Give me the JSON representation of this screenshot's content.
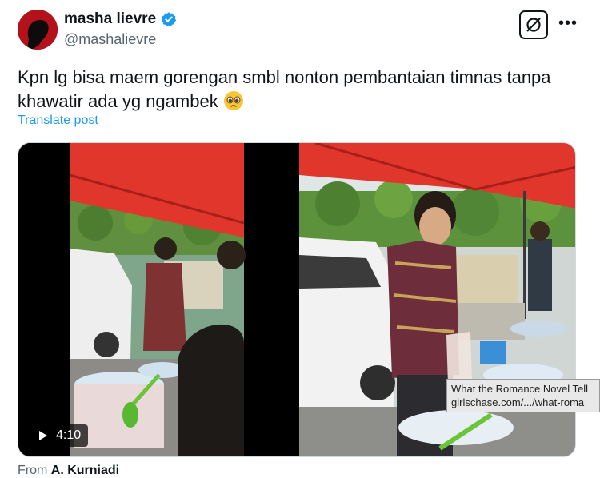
{
  "tweet": {
    "display_name": "masha lievre",
    "handle": "@mashalievre",
    "text": "Kpn lg bisa maem gorengan smbl nonton pembantaian timnas tanpa khawatir ada yg ngambek",
    "translate_label": "Translate post",
    "icons": {
      "avatar": "avatar",
      "verified": "verified-badge-icon",
      "grok": "grok-icon",
      "more": "more-options-icon",
      "emoji": "pleading-face-emoji"
    }
  },
  "media": {
    "video_duration": "4:10",
    "play_icon": "play-icon"
  },
  "tooltip": {
    "line1": "What the Romance Novel Tell",
    "line2": "girlschase.com/.../what-roma"
  },
  "source": {
    "prefix": "From",
    "name": "A. Kurniadi"
  },
  "colors": {
    "accent": "#1d9bf0",
    "text": "#0f1419",
    "secondary": "#536471",
    "avatar_bg": "#b3121b",
    "umbrella": "#e0362c"
  }
}
